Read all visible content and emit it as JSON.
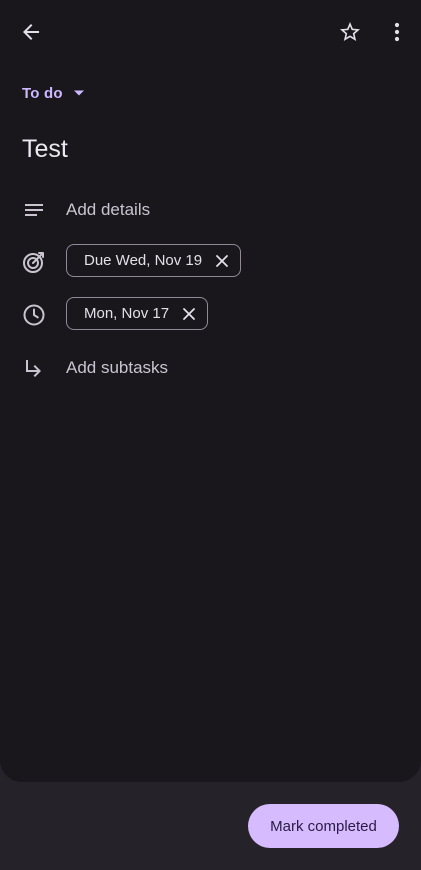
{
  "toolbar": {
    "back_icon": "arrow-left-icon",
    "star_icon": "star-outline-icon",
    "more_icon": "more-vert-icon"
  },
  "list_selector": {
    "label": "To do",
    "icon": "dropdown-arrow-icon",
    "color": "#cdb8ff"
  },
  "task": {
    "title": "Test"
  },
  "details": {
    "placeholder": "Add details",
    "icon": "notes-icon"
  },
  "due_date": {
    "label": "Due Wed, Nov 19",
    "icon": "target-icon"
  },
  "reminder": {
    "label": "Mon, Nov 17",
    "icon": "clock-icon"
  },
  "subtasks": {
    "placeholder": "Add subtasks",
    "icon": "subdirectory-arrow-icon"
  },
  "actions": {
    "mark_completed": "Mark completed",
    "accent": "#d6bcff"
  }
}
